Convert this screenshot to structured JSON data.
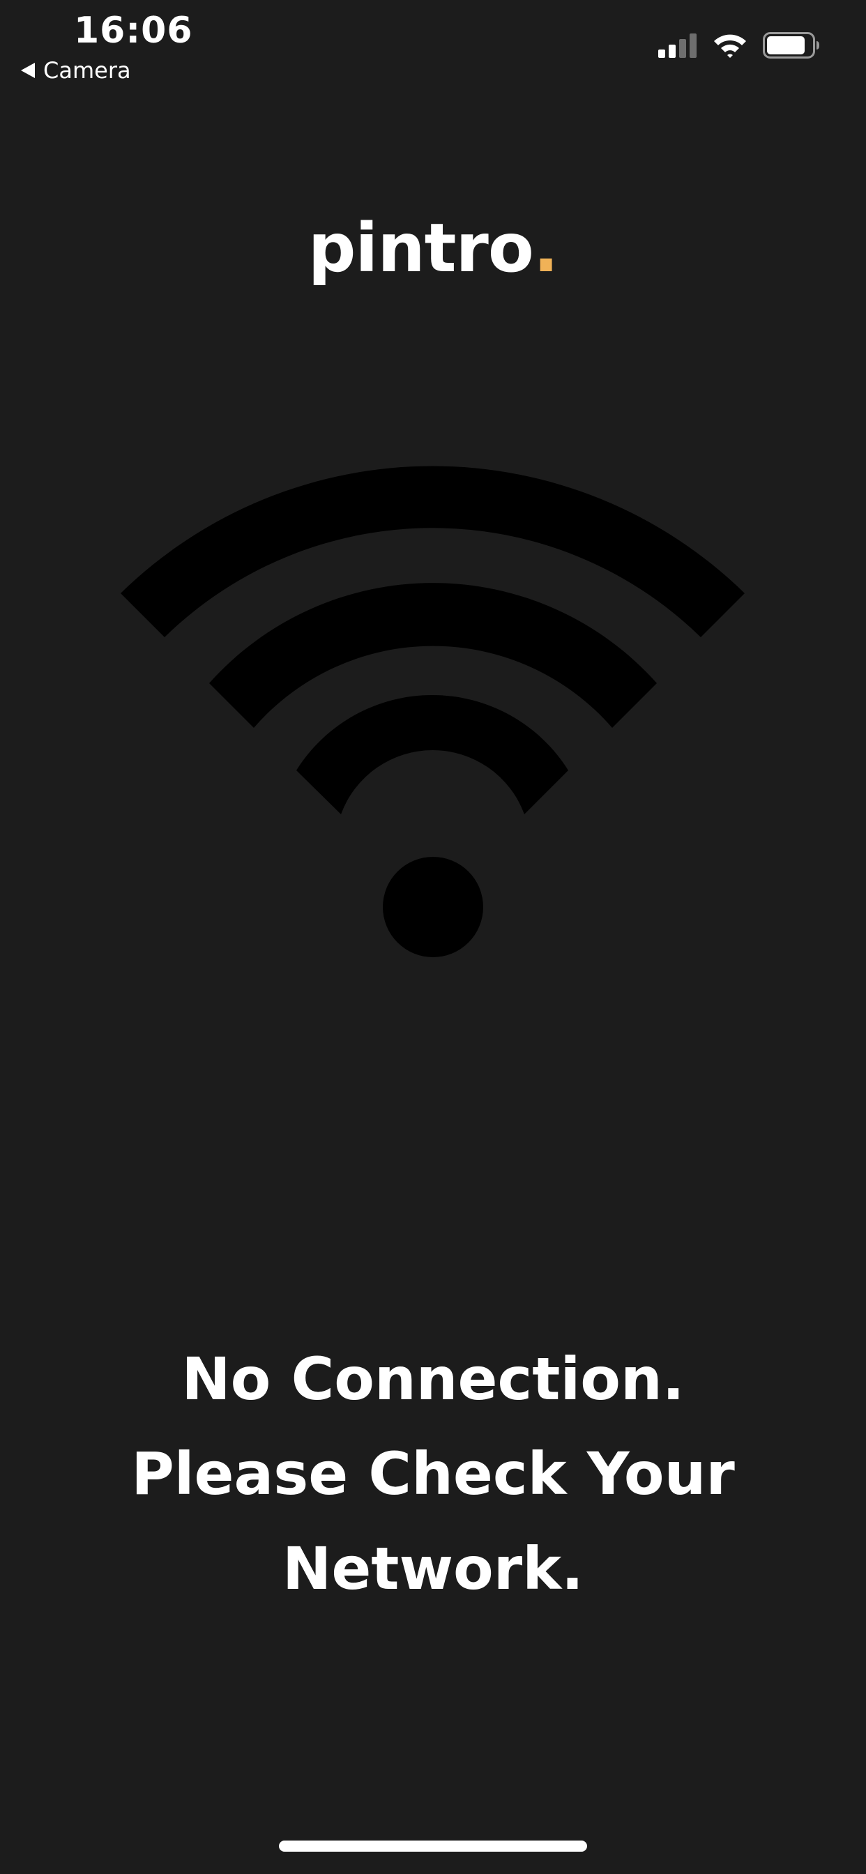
{
  "status_bar": {
    "time": "16:06",
    "back_label": "Camera",
    "cellular_level": 0.5,
    "battery_level": 0.85
  },
  "logo": {
    "text": "pintro",
    "dot": ".",
    "dot_color": "#f0b257"
  },
  "graphic": {
    "icon": "wifi-icon",
    "color": "#000000"
  },
  "message": {
    "line1": "No Connection.",
    "line2": "Please Check Your",
    "line3": "Network."
  },
  "colors": {
    "background": "#1c1c1c",
    "text": "#ffffff"
  }
}
